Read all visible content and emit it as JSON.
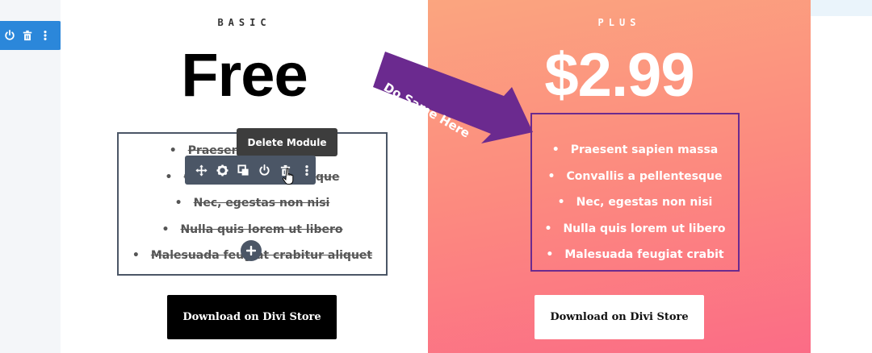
{
  "columns": {
    "basic": {
      "plan_label": "BASIC",
      "price": "Free",
      "features": [
        "Praesent sapien massa",
        "Convallis a pellentesque",
        "Nec, egestas non nisi",
        "Nulla quis lorem ut libero",
        "Malesuada feugiat crabitur aliquet"
      ],
      "button_label": "Download on Divi Store"
    },
    "plus": {
      "plan_label": "PLUS",
      "price": "$2.99",
      "features": [
        "Praesent sapien massa",
        "Convallis a pellentesque",
        "Nec, egestas non nisi",
        "Nulla quis lorem ut libero",
        "Malesuada feugiat crabit"
      ],
      "button_label": "Download on Divi Store"
    }
  },
  "builder": {
    "tooltip": "Delete Module",
    "callout": "Do Same Here",
    "row_toolbar_icons": [
      "power-icon",
      "trash-icon",
      "more-icon"
    ],
    "module_toolbar_icons": [
      "move-icon",
      "gear-icon",
      "duplicate-icon",
      "power-icon",
      "trash-icon",
      "more-icon"
    ]
  },
  "colors": {
    "builder_blue": "#2b87da",
    "module_gray": "#4b5666",
    "callout_purple": "#6b2a8f",
    "plus_gradient_start": "#fba57f",
    "plus_gradient_end": "#fb6c86"
  }
}
